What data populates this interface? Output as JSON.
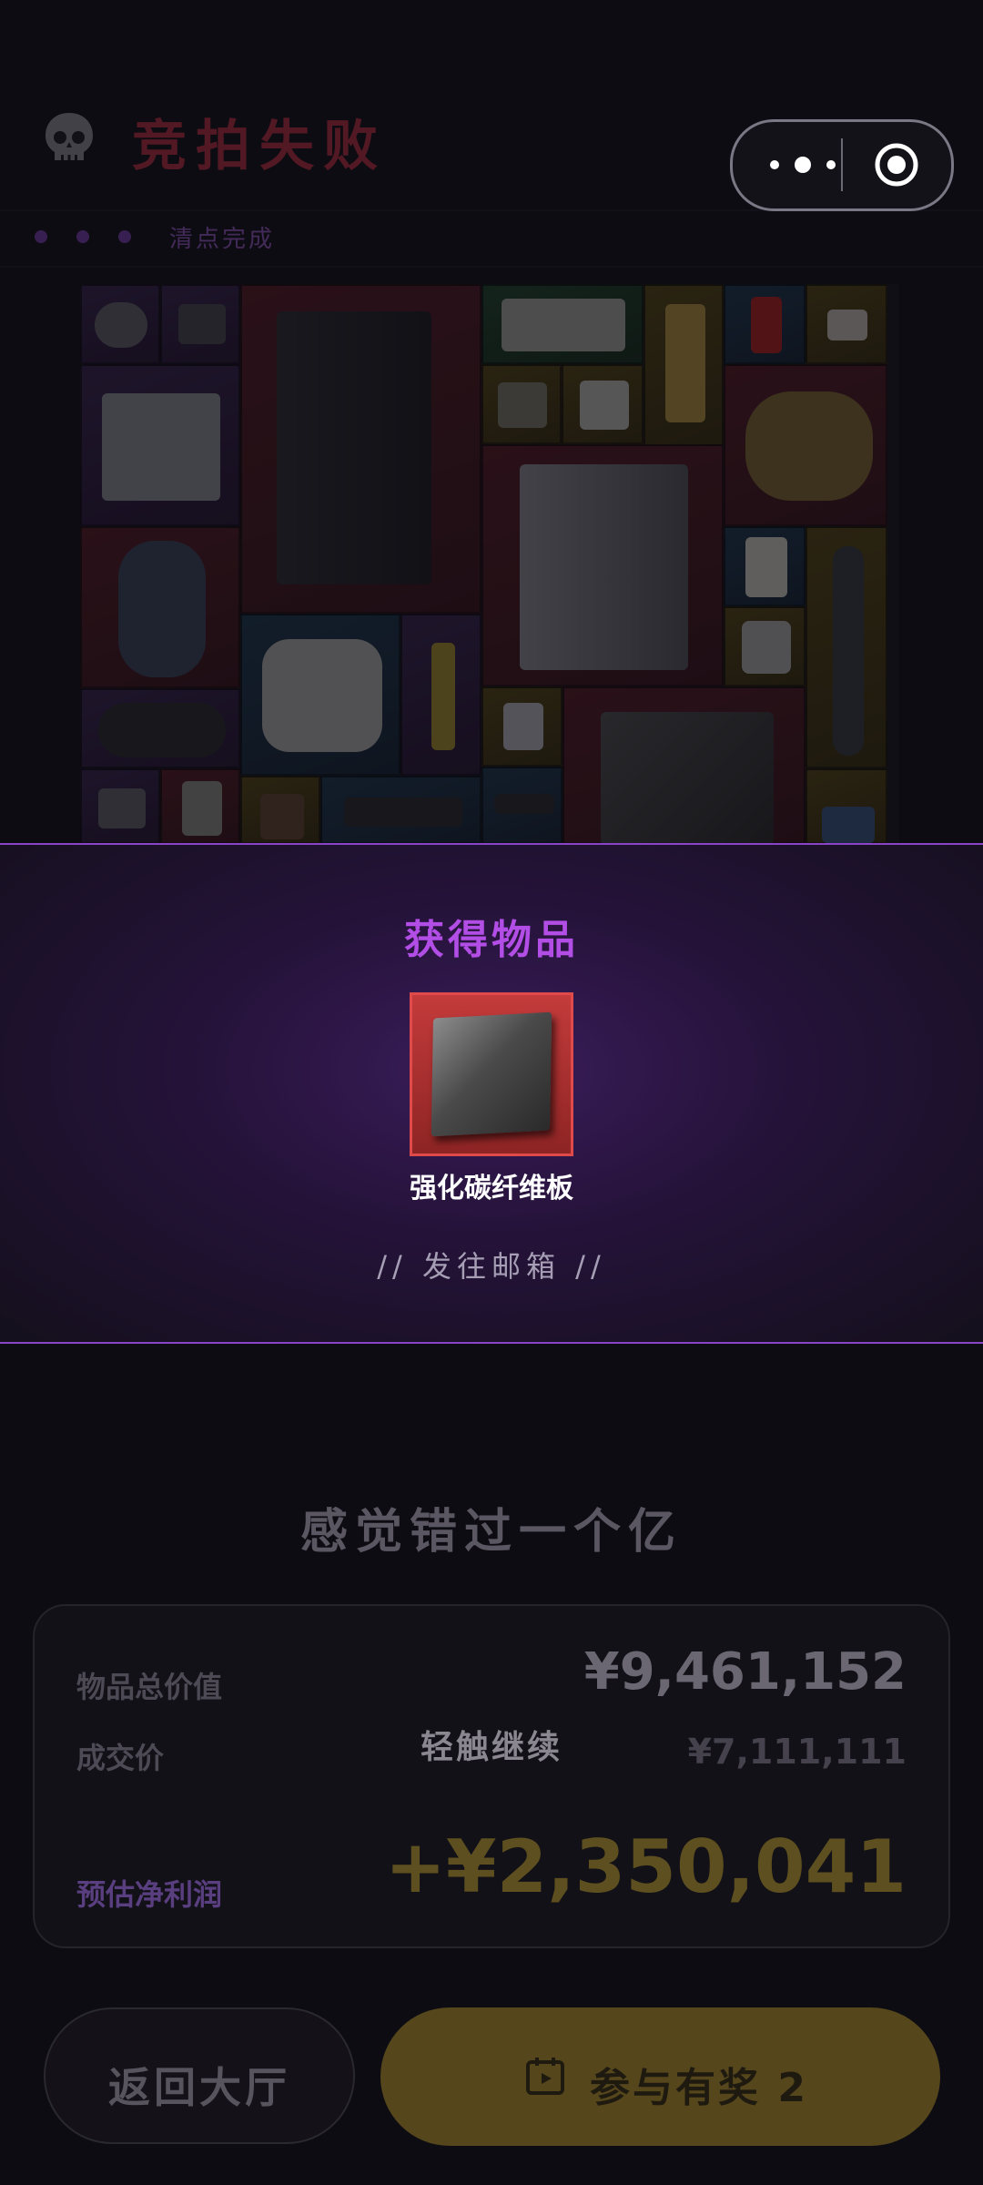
{
  "header": {
    "title": "竞拍失败",
    "progress_label": "清点完成"
  },
  "miniprogram_capsule": {
    "menu_icon": "more-dots-icon",
    "close_icon": "target-circle-icon"
  },
  "reward_modal": {
    "title": "获得物品",
    "item_name": "强化碳纤维板",
    "mail_text": "// 发往邮箱 //",
    "item_rarity_color": "#c43b3b"
  },
  "summary": {
    "headline": "感觉错过一个亿",
    "tap_to_continue": "轻触继续",
    "rows": [
      {
        "label": "物品总价值",
        "value": "¥9,461,152"
      },
      {
        "label": "成交价",
        "value": "¥7,111,111"
      },
      {
        "label": "预估净利润",
        "value": "+¥2,350,041"
      }
    ]
  },
  "buttons": {
    "back": "返回大厅",
    "join": "参与有奖 2"
  },
  "colors": {
    "accent_purple": "#b24de6",
    "fail_red": "#c22d3f",
    "gold": "#d6a632"
  }
}
